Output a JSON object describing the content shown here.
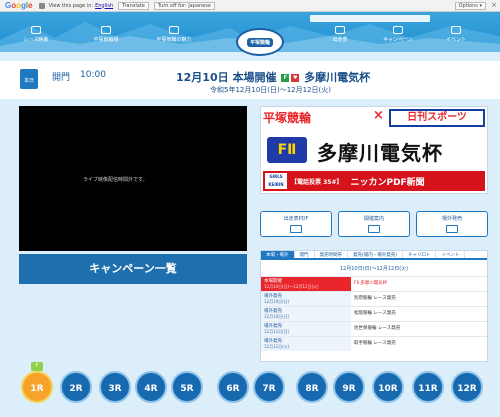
{
  "translate_bar": {
    "prefix": "View this page in:",
    "language": "English",
    "translate_btn": "Translate",
    "turn_off_btn": "Turn off for: Japanese",
    "options_btn": "Options ▾",
    "close": "×"
  },
  "nav": {
    "items": [
      "レース映像",
      "平塚競輪場",
      "平塚競輪の魅力",
      "",
      "出走表",
      "キャンペーン",
      "イベント"
    ],
    "logo": "平塚競輪"
  },
  "event": {
    "open_label": "開門",
    "open_time": "10:00",
    "title_prefix": "12月10日 本場開催",
    "badge1": "F",
    "badge2": "♥",
    "title_name": "多摩川電気杯",
    "dates": "令和5年12月10日(日)～12月12日(火)",
    "calendar_label": "本日"
  },
  "video": {
    "message": "ライブ映像配信時間外です。"
  },
  "campaign_label": "キャンペーン一覧",
  "banner": {
    "left_title": "平塚競輪",
    "cross": "×",
    "sports": "日刊スポーツ",
    "grade": "FⅡ",
    "name": "多摩川電気杯",
    "girls": "GIRLS KEIRIN",
    "vote": "【電話投票 35#】",
    "pdf": "ニッカンPDF新聞"
  },
  "buttons": [
    "出走表PDF",
    "開催案内",
    "場外発売"
  ],
  "panel": {
    "tabs": [
      "本場・場外",
      "開門",
      "発売時間帯",
      "発売(場内・場外発売)",
      "チャリロト",
      "イベント"
    ],
    "period": "12月10日(日)～12月12日(火)",
    "rows": [
      {
        "head": "本場開催",
        "sub": "12月10日(日)～12月12日(火)",
        "value": "FⅡ 多摩川電気杯"
      },
      {
        "head": "場外発売",
        "sub": "12月10日(日)",
        "value": "別府競輪 レース発売"
      },
      {
        "head": "場外発売",
        "sub": "12月10日(日)",
        "value": "松阪競輪 レース発売"
      },
      {
        "head": "場外発売",
        "sub": "12月11日(月)",
        "value": "佐世保競輪 レース発売"
      },
      {
        "head": "場外発売",
        "sub": "12月12日(火)",
        "value": "取手競輪 レース発売"
      }
    ]
  },
  "races": [
    "1R",
    "2R",
    "3R",
    "4R",
    "5R",
    "6R",
    "7R",
    "8R",
    "9R",
    "10R",
    "11R",
    "12R"
  ],
  "race_flag": "F",
  "colors": {
    "primary": "#1f78c1",
    "accent": "#e8262c",
    "active_race": "#f6a22b"
  }
}
